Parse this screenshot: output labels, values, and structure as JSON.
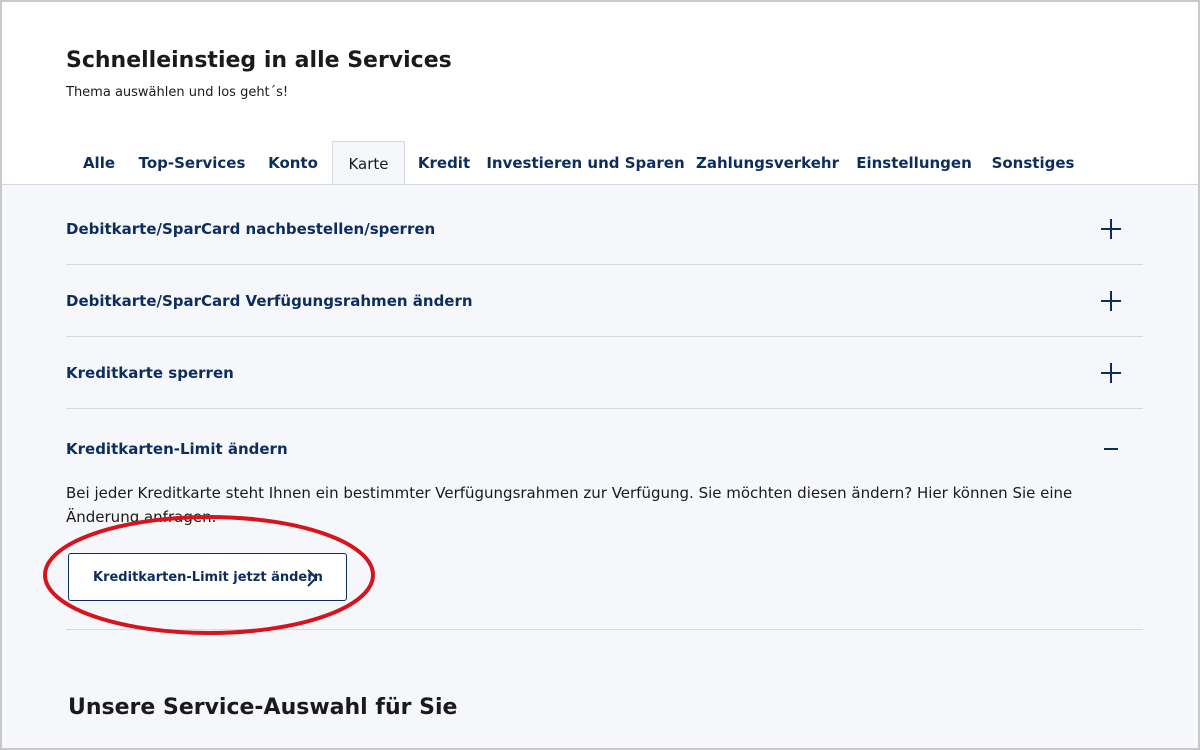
{
  "header": {
    "title": "Schnelleinstieg in alle Services",
    "subtitle": "Thema auswählen und los geht´s!"
  },
  "tabs": [
    {
      "label": "Alle",
      "active": false
    },
    {
      "label": "Top-Services",
      "active": false
    },
    {
      "label": "Konto",
      "active": false
    },
    {
      "label": "Karte",
      "active": true
    },
    {
      "label": "Kredit",
      "active": false
    },
    {
      "label": "Investieren und Sparen",
      "active": false
    },
    {
      "label": "Zahlungsverkehr",
      "active": false
    },
    {
      "label": "Einstellungen",
      "active": false
    },
    {
      "label": "Sonstiges",
      "active": false
    }
  ],
  "accordion": {
    "items": [
      {
        "label": "Debitkarte/SparCard nachbestellen/sperren",
        "icon": "plus-icon",
        "expanded": false
      },
      {
        "label": "Debitkarte/SparCard Verfügungsrahmen ändern",
        "icon": "plus-icon",
        "expanded": false
      },
      {
        "label": "Kreditkarte sperren",
        "icon": "plus-icon",
        "expanded": false
      },
      {
        "label": "Kreditkarten-Limit ändern",
        "icon": "minus-icon",
        "expanded": true,
        "description": "Bei jeder Kreditkarte steht Ihnen ein bestimmter Verfügungsrahmen zur Verfügung. Sie möchten diesen ändern? Hier können Sie eine Änderung anfragen.",
        "button_label": "Kreditkarten-Limit jetzt ändern"
      }
    ]
  },
  "section": {
    "title": "Unsere Service-Auswahl für Sie"
  },
  "colors": {
    "brand_navy": "#0c2d5e",
    "panel_bg": "#f5f7fa",
    "highlight_red": "#d7141e"
  }
}
